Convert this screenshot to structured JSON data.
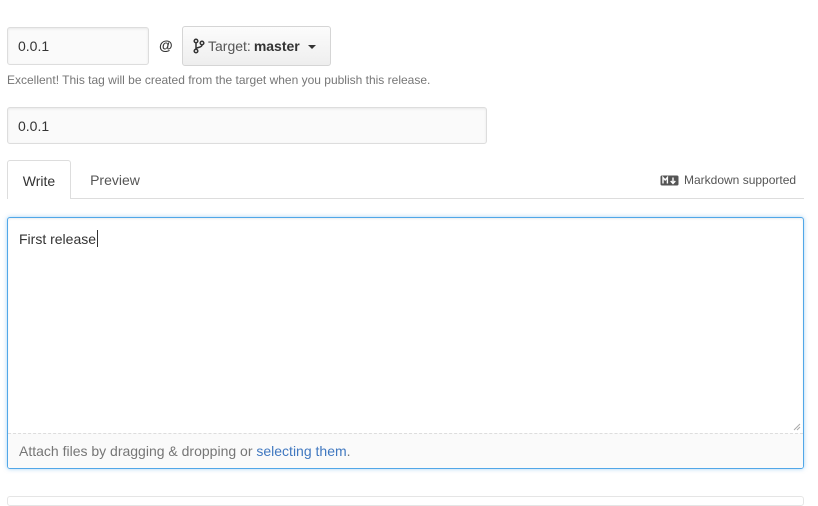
{
  "tag": {
    "version_value": "0.0.1",
    "at_symbol": "@",
    "target_label": "Target:",
    "target_branch": "master",
    "note": "Excellent! This tag will be created from the target when you publish this release."
  },
  "release_title": {
    "value": "0.0.1"
  },
  "tabs": [
    {
      "label": "Write",
      "selected": true
    },
    {
      "label": "Preview",
      "selected": false
    }
  ],
  "markdown_hint": "Markdown supported",
  "editor": {
    "text": "First release",
    "attach_prefix": "Attach files by dragging & dropping or ",
    "attach_link": "selecting them",
    "attach_suffix": "."
  },
  "colors": {
    "focus_border": "#51a7e8",
    "link": "#4078c0",
    "muted_text": "#767676"
  }
}
